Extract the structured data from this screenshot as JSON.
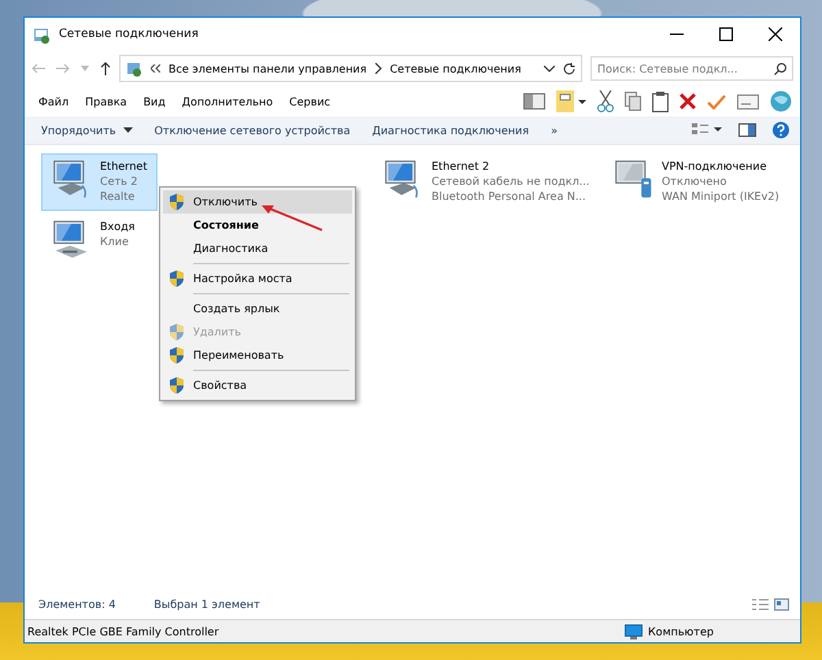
{
  "window": {
    "title": "Сетевые подключения"
  },
  "address": {
    "crumbs": [
      "Все элементы панели управления",
      "Сетевые подключения"
    ],
    "search_placeholder": "Поиск: Сетевые подкл..."
  },
  "menu_bar": [
    "Файл",
    "Правка",
    "Вид",
    "Дополнительно",
    "Сервис"
  ],
  "command_bar": [
    {
      "label": "Упорядочить",
      "dropdown": true
    },
    {
      "label": "Отключение сетевого устройства",
      "dropdown": false
    },
    {
      "label": "Диагностика подключения",
      "dropdown": false
    },
    {
      "label": "»",
      "dropdown": false
    }
  ],
  "connections": [
    {
      "name": "Ethernet",
      "line_1": "Сеть 2",
      "line_2": "Realte",
      "kind": "wired",
      "selected": true
    },
    {
      "name": "Ethernet 2",
      "line_1": "Сетевой кабель не подкл...",
      "line_2": "Bluetooth Personal Area N...",
      "kind": "wired",
      "selected": false
    },
    {
      "name": "VPN-подключение",
      "line_1": "Отключено",
      "line_2": "WAN Miniport (IKEv2)",
      "kind": "vpn",
      "selected": false
    },
    {
      "name": "Входя",
      "line_1": "Клие",
      "kind": "incoming",
      "selected": false
    }
  ],
  "context_menu": [
    {
      "kind": "item",
      "label": "Отключить",
      "shield": true,
      "bold": false,
      "disabled": false,
      "selected": true
    },
    {
      "kind": "item",
      "label": "Состояние",
      "shield": false,
      "bold": true,
      "disabled": false,
      "selected": false
    },
    {
      "kind": "item",
      "label": "Диагностика",
      "shield": false,
      "bold": false,
      "disabled": false,
      "selected": false
    },
    {
      "kind": "separator"
    },
    {
      "kind": "item",
      "label": "Настройка моста",
      "shield": true,
      "bold": false,
      "disabled": false,
      "selected": false
    },
    {
      "kind": "separator"
    },
    {
      "kind": "item",
      "label": "Создать ярлык",
      "shield": false,
      "bold": false,
      "disabled": false,
      "selected": false
    },
    {
      "kind": "item",
      "label": "Удалить",
      "shield": true,
      "bold": false,
      "disabled": true,
      "selected": false
    },
    {
      "kind": "item",
      "label": "Переименовать",
      "shield": true,
      "bold": false,
      "disabled": false,
      "selected": false
    },
    {
      "kind": "separator"
    },
    {
      "kind": "item",
      "label": "Свойства",
      "shield": true,
      "bold": false,
      "disabled": false,
      "selected": false
    }
  ],
  "status": {
    "count": "Элементов: 4",
    "selection": "Выбран 1 элемент"
  },
  "details_bar": {
    "device": "Realtek PCIe GBE Family Controller",
    "zone": "Компьютер"
  }
}
